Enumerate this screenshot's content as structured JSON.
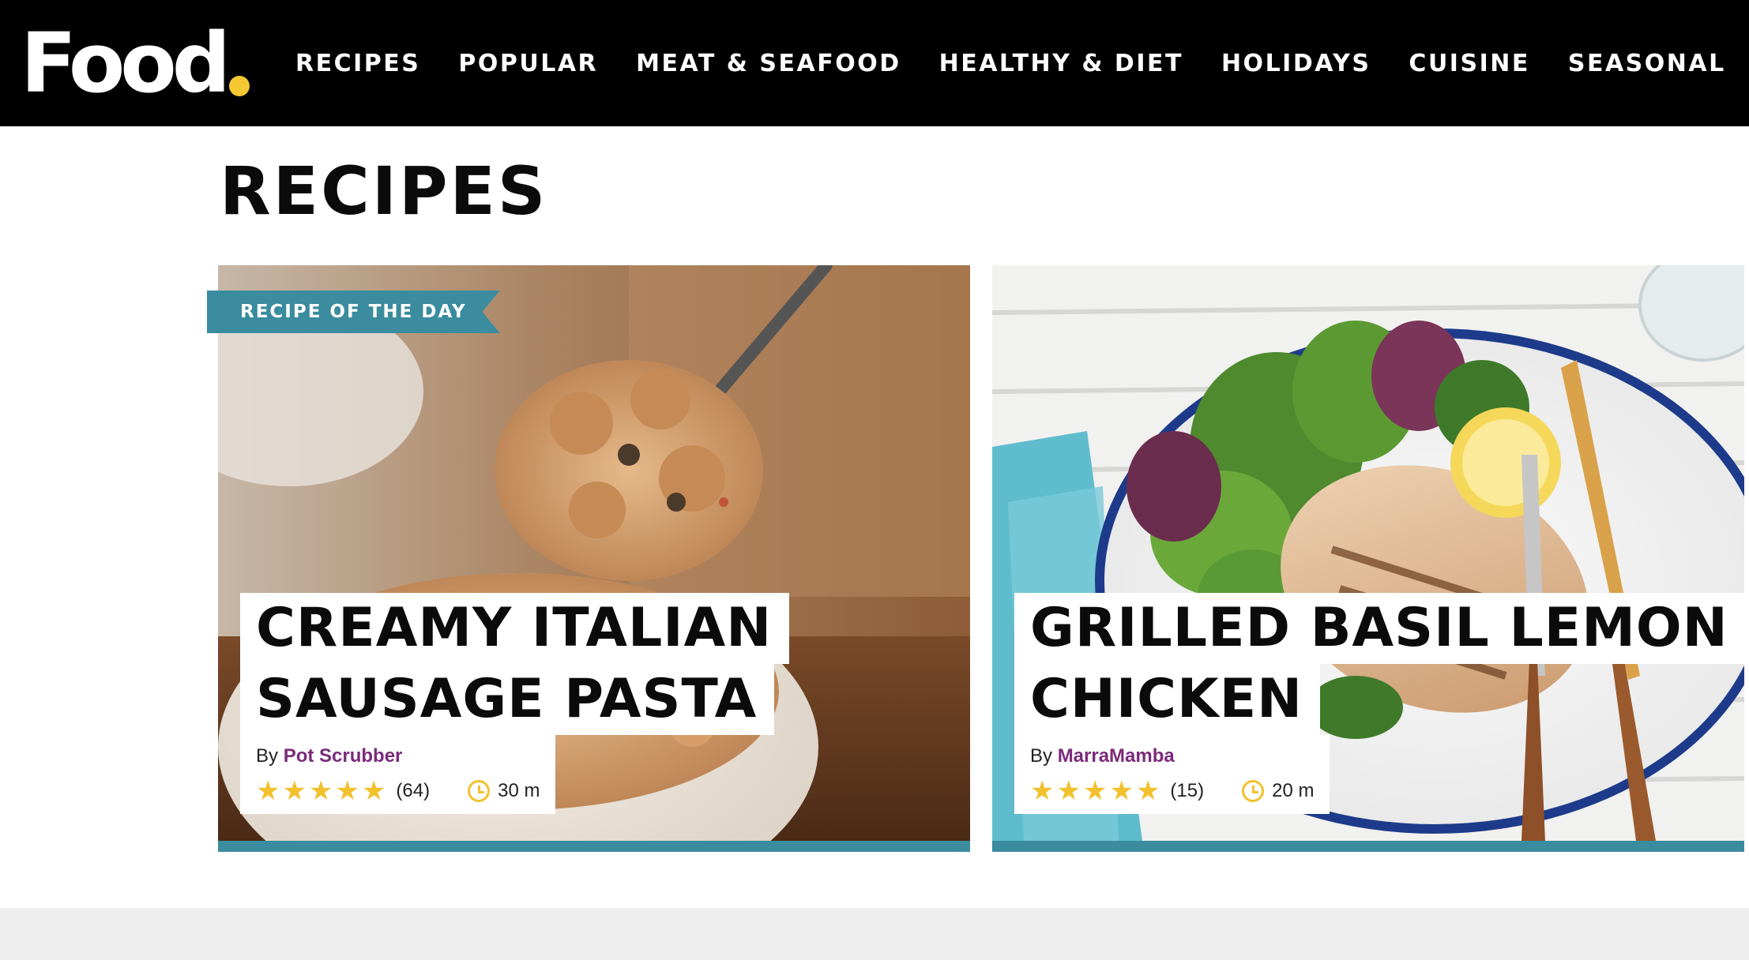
{
  "brand": {
    "logo_text": "Food",
    "accent_color": "#f5c832"
  },
  "nav": {
    "items": [
      "RECIPES",
      "POPULAR",
      "MEAT & SEAFOOD",
      "HEALTHY & DIET",
      "HOLIDAYS",
      "CUISINE",
      "SEASONAL"
    ]
  },
  "page": {
    "title": "RECIPES"
  },
  "cards": [
    {
      "badge": "RECIPE OF THE DAY",
      "title_lines": [
        "CREAMY ITALIAN",
        "SAUSAGE PASTA"
      ],
      "by_label": "By",
      "author": "Pot Scrubber",
      "rating_stars": 5,
      "review_count": "(64)",
      "time": "30 m",
      "image": "pasta-photo"
    },
    {
      "title_lines": [
        "GRILLED BASIL LEMON",
        "CHICKEN"
      ],
      "by_label": "By",
      "author": "MarraMamba",
      "rating_stars": 5,
      "review_count": "(15)",
      "time": "20 m",
      "image": "chicken-photo"
    }
  ],
  "colors": {
    "teal": "#3a8c9e",
    "author": "#7b2a7a",
    "star": "#f2c12e"
  },
  "icons": {
    "star": "star-icon",
    "time": "clock-icon"
  }
}
